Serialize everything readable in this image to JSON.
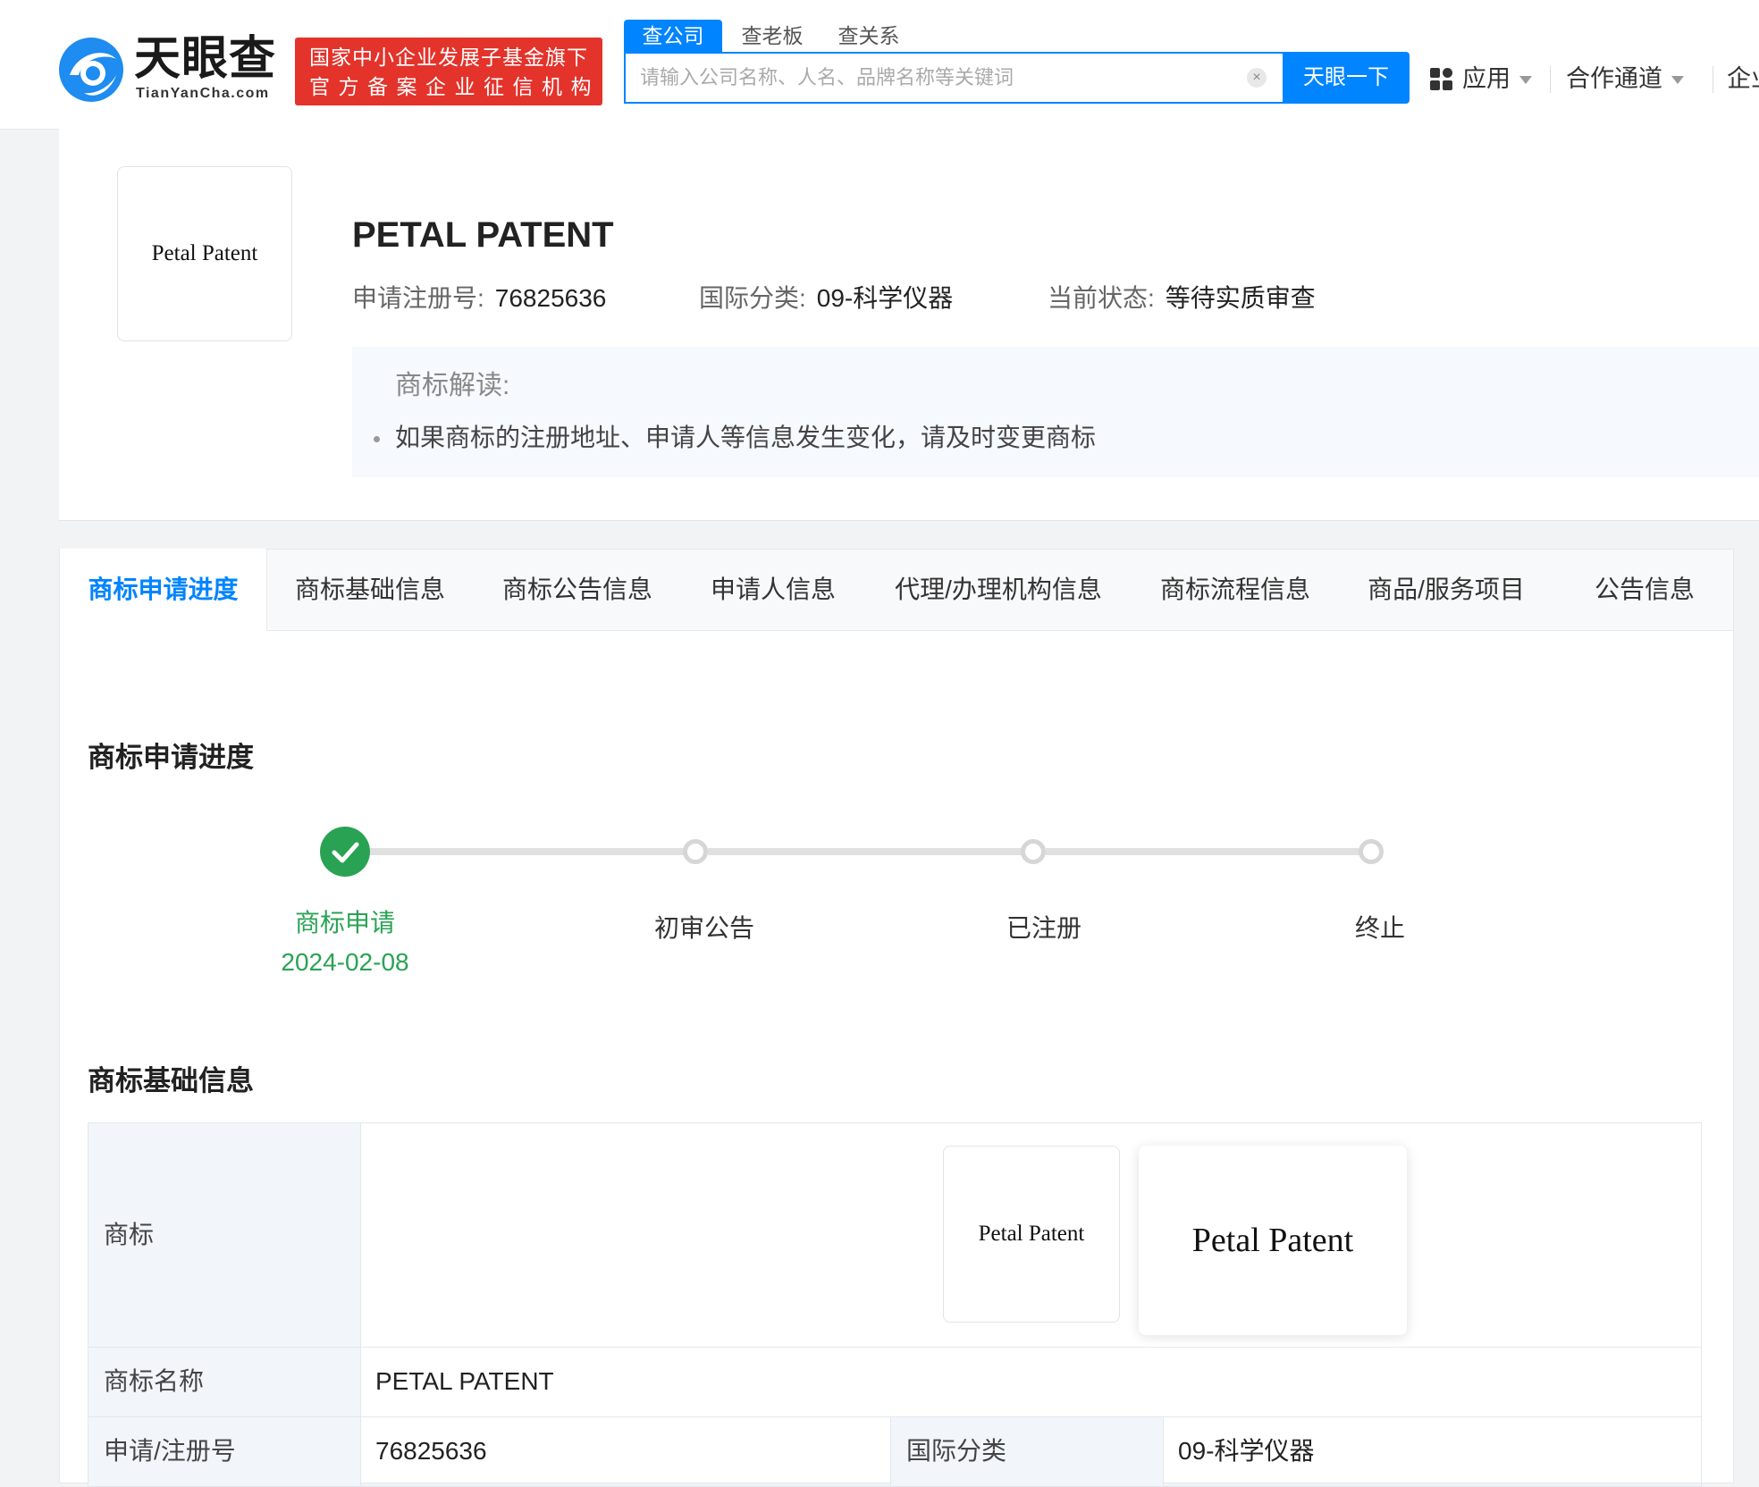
{
  "header": {
    "logo_text": "天眼查",
    "logo_sub": "TianYanCha.com",
    "badge_line1": "国家中小企业发展子基金旗下",
    "badge_line2": "官方备案企业征信机构",
    "search_tabs": [
      "查公司",
      "查老板",
      "查关系"
    ],
    "search_placeholder": "请输入公司名称、人名、品牌名称等关键词",
    "search_clear": "×",
    "search_button": "天眼一下",
    "nav": {
      "apps_label": "应用",
      "partner_label": "合作通道",
      "enterprise_partial": "企业"
    },
    "icons": [
      "tianyancha-logo-icon",
      "apps-grid-icon",
      "chevron-down-icon"
    ]
  },
  "trademark": {
    "logo_word": "Petal Patent",
    "name": "PETAL PATENT",
    "reg_no_label": "申请注册号:",
    "reg_no": "76825636",
    "class_label": "国际分类:",
    "class_value": "09-科学仪器",
    "status_label": "当前状态:",
    "status_value": "等待实质审查"
  },
  "interpretation": {
    "title": "商标解读:",
    "items": [
      "如果商标的注册地址、申请人等信息发生变化，请及时变更商标"
    ]
  },
  "tabs": [
    "商标申请进度",
    "商标基础信息",
    "商标公告信息",
    "申请人信息",
    "代理/办理机构信息",
    "商标流程信息",
    "商品/服务项目",
    "公告信息"
  ],
  "progress": {
    "title": "商标申请进度",
    "steps": [
      {
        "label": "商标申请",
        "date": "2024-02-08",
        "done": true
      },
      {
        "label": "初审公告",
        "date": "",
        "done": false
      },
      {
        "label": "已注册",
        "date": "",
        "done": false
      },
      {
        "label": "终止",
        "date": "",
        "done": false
      }
    ],
    "done_color": "#29a353"
  },
  "basic_info": {
    "title": "商标基础信息",
    "rows": {
      "trademark_label": "商标",
      "name_label": "商标名称",
      "name_value": "PETAL PATENT",
      "reg_label": "申请/注册号",
      "reg_value": "76825636",
      "class_label": "国际分类",
      "class_value": "09-科学仪器"
    }
  },
  "colors": {
    "brand_blue": "#0084ff",
    "badge_red": "#e3332b",
    "success_green": "#29a353"
  }
}
